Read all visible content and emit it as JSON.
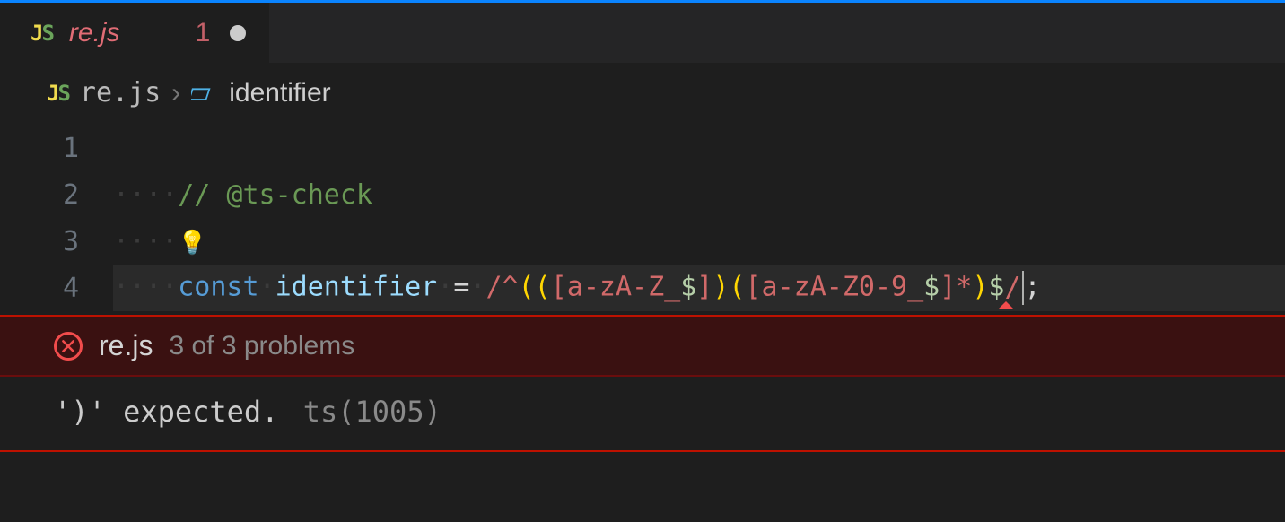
{
  "tab": {
    "filename": "re.js",
    "error_count": "1",
    "language_icon": "js",
    "dirty": true
  },
  "breadcrumb": {
    "filename": "re.js",
    "symbol_name": "identifier"
  },
  "lines": {
    "l1_num": "1",
    "l2_num": "2",
    "l3_num": "3",
    "l4_num": "4",
    "l2_comment": "// @ts-check",
    "l4_const": "const",
    "l4_ident": "identifier",
    "l4_equals": "=",
    "l4_regex_open": "/^",
    "l4_regex_body": "(([a-zA-Z_$])([a-zA-Z0-9_$]*)$",
    "l4_regex_close": "/",
    "l4_semicolon": ";"
  },
  "problems": {
    "file": "re.js",
    "count_text": "3 of 3 problems",
    "message": "')' expected.",
    "source": "ts(1005)"
  },
  "colors": {
    "accent_top": "#0a84ff",
    "error": "#f14c4c"
  }
}
